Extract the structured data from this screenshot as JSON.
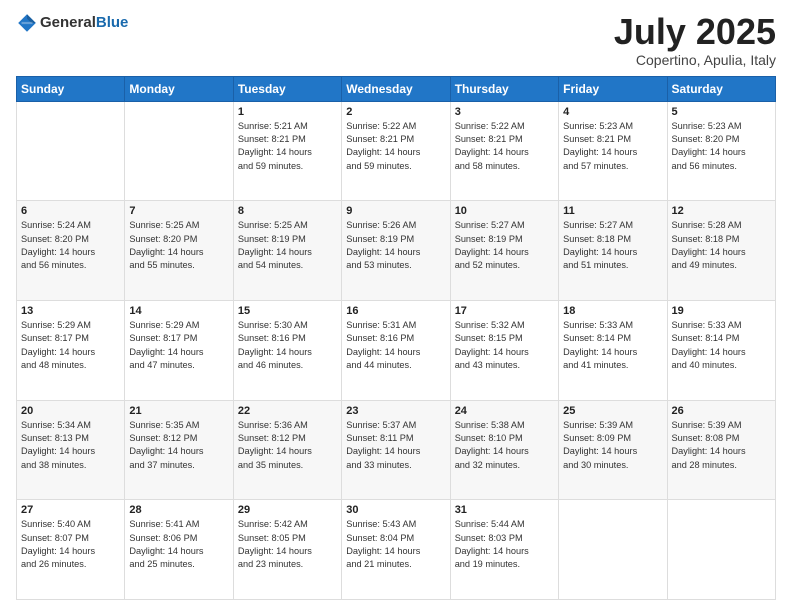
{
  "header": {
    "logo": {
      "general": "General",
      "blue": "Blue"
    },
    "title": "July 2025",
    "location": "Copertino, Apulia, Italy"
  },
  "calendar": {
    "days_of_week": [
      "Sunday",
      "Monday",
      "Tuesday",
      "Wednesday",
      "Thursday",
      "Friday",
      "Saturday"
    ],
    "weeks": [
      [
        {
          "day": "",
          "info": ""
        },
        {
          "day": "",
          "info": ""
        },
        {
          "day": "1",
          "info": "Sunrise: 5:21 AM\nSunset: 8:21 PM\nDaylight: 14 hours\nand 59 minutes."
        },
        {
          "day": "2",
          "info": "Sunrise: 5:22 AM\nSunset: 8:21 PM\nDaylight: 14 hours\nand 59 minutes."
        },
        {
          "day": "3",
          "info": "Sunrise: 5:22 AM\nSunset: 8:21 PM\nDaylight: 14 hours\nand 58 minutes."
        },
        {
          "day": "4",
          "info": "Sunrise: 5:23 AM\nSunset: 8:21 PM\nDaylight: 14 hours\nand 57 minutes."
        },
        {
          "day": "5",
          "info": "Sunrise: 5:23 AM\nSunset: 8:20 PM\nDaylight: 14 hours\nand 56 minutes."
        }
      ],
      [
        {
          "day": "6",
          "info": "Sunrise: 5:24 AM\nSunset: 8:20 PM\nDaylight: 14 hours\nand 56 minutes."
        },
        {
          "day": "7",
          "info": "Sunrise: 5:25 AM\nSunset: 8:20 PM\nDaylight: 14 hours\nand 55 minutes."
        },
        {
          "day": "8",
          "info": "Sunrise: 5:25 AM\nSunset: 8:19 PM\nDaylight: 14 hours\nand 54 minutes."
        },
        {
          "day": "9",
          "info": "Sunrise: 5:26 AM\nSunset: 8:19 PM\nDaylight: 14 hours\nand 53 minutes."
        },
        {
          "day": "10",
          "info": "Sunrise: 5:27 AM\nSunset: 8:19 PM\nDaylight: 14 hours\nand 52 minutes."
        },
        {
          "day": "11",
          "info": "Sunrise: 5:27 AM\nSunset: 8:18 PM\nDaylight: 14 hours\nand 51 minutes."
        },
        {
          "day": "12",
          "info": "Sunrise: 5:28 AM\nSunset: 8:18 PM\nDaylight: 14 hours\nand 49 minutes."
        }
      ],
      [
        {
          "day": "13",
          "info": "Sunrise: 5:29 AM\nSunset: 8:17 PM\nDaylight: 14 hours\nand 48 minutes."
        },
        {
          "day": "14",
          "info": "Sunrise: 5:29 AM\nSunset: 8:17 PM\nDaylight: 14 hours\nand 47 minutes."
        },
        {
          "day": "15",
          "info": "Sunrise: 5:30 AM\nSunset: 8:16 PM\nDaylight: 14 hours\nand 46 minutes."
        },
        {
          "day": "16",
          "info": "Sunrise: 5:31 AM\nSunset: 8:16 PM\nDaylight: 14 hours\nand 44 minutes."
        },
        {
          "day": "17",
          "info": "Sunrise: 5:32 AM\nSunset: 8:15 PM\nDaylight: 14 hours\nand 43 minutes."
        },
        {
          "day": "18",
          "info": "Sunrise: 5:33 AM\nSunset: 8:14 PM\nDaylight: 14 hours\nand 41 minutes."
        },
        {
          "day": "19",
          "info": "Sunrise: 5:33 AM\nSunset: 8:14 PM\nDaylight: 14 hours\nand 40 minutes."
        }
      ],
      [
        {
          "day": "20",
          "info": "Sunrise: 5:34 AM\nSunset: 8:13 PM\nDaylight: 14 hours\nand 38 minutes."
        },
        {
          "day": "21",
          "info": "Sunrise: 5:35 AM\nSunset: 8:12 PM\nDaylight: 14 hours\nand 37 minutes."
        },
        {
          "day": "22",
          "info": "Sunrise: 5:36 AM\nSunset: 8:12 PM\nDaylight: 14 hours\nand 35 minutes."
        },
        {
          "day": "23",
          "info": "Sunrise: 5:37 AM\nSunset: 8:11 PM\nDaylight: 14 hours\nand 33 minutes."
        },
        {
          "day": "24",
          "info": "Sunrise: 5:38 AM\nSunset: 8:10 PM\nDaylight: 14 hours\nand 32 minutes."
        },
        {
          "day": "25",
          "info": "Sunrise: 5:39 AM\nSunset: 8:09 PM\nDaylight: 14 hours\nand 30 minutes."
        },
        {
          "day": "26",
          "info": "Sunrise: 5:39 AM\nSunset: 8:08 PM\nDaylight: 14 hours\nand 28 minutes."
        }
      ],
      [
        {
          "day": "27",
          "info": "Sunrise: 5:40 AM\nSunset: 8:07 PM\nDaylight: 14 hours\nand 26 minutes."
        },
        {
          "day": "28",
          "info": "Sunrise: 5:41 AM\nSunset: 8:06 PM\nDaylight: 14 hours\nand 25 minutes."
        },
        {
          "day": "29",
          "info": "Sunrise: 5:42 AM\nSunset: 8:05 PM\nDaylight: 14 hours\nand 23 minutes."
        },
        {
          "day": "30",
          "info": "Sunrise: 5:43 AM\nSunset: 8:04 PM\nDaylight: 14 hours\nand 21 minutes."
        },
        {
          "day": "31",
          "info": "Sunrise: 5:44 AM\nSunset: 8:03 PM\nDaylight: 14 hours\nand 19 minutes."
        },
        {
          "day": "",
          "info": ""
        },
        {
          "day": "",
          "info": ""
        }
      ]
    ]
  }
}
